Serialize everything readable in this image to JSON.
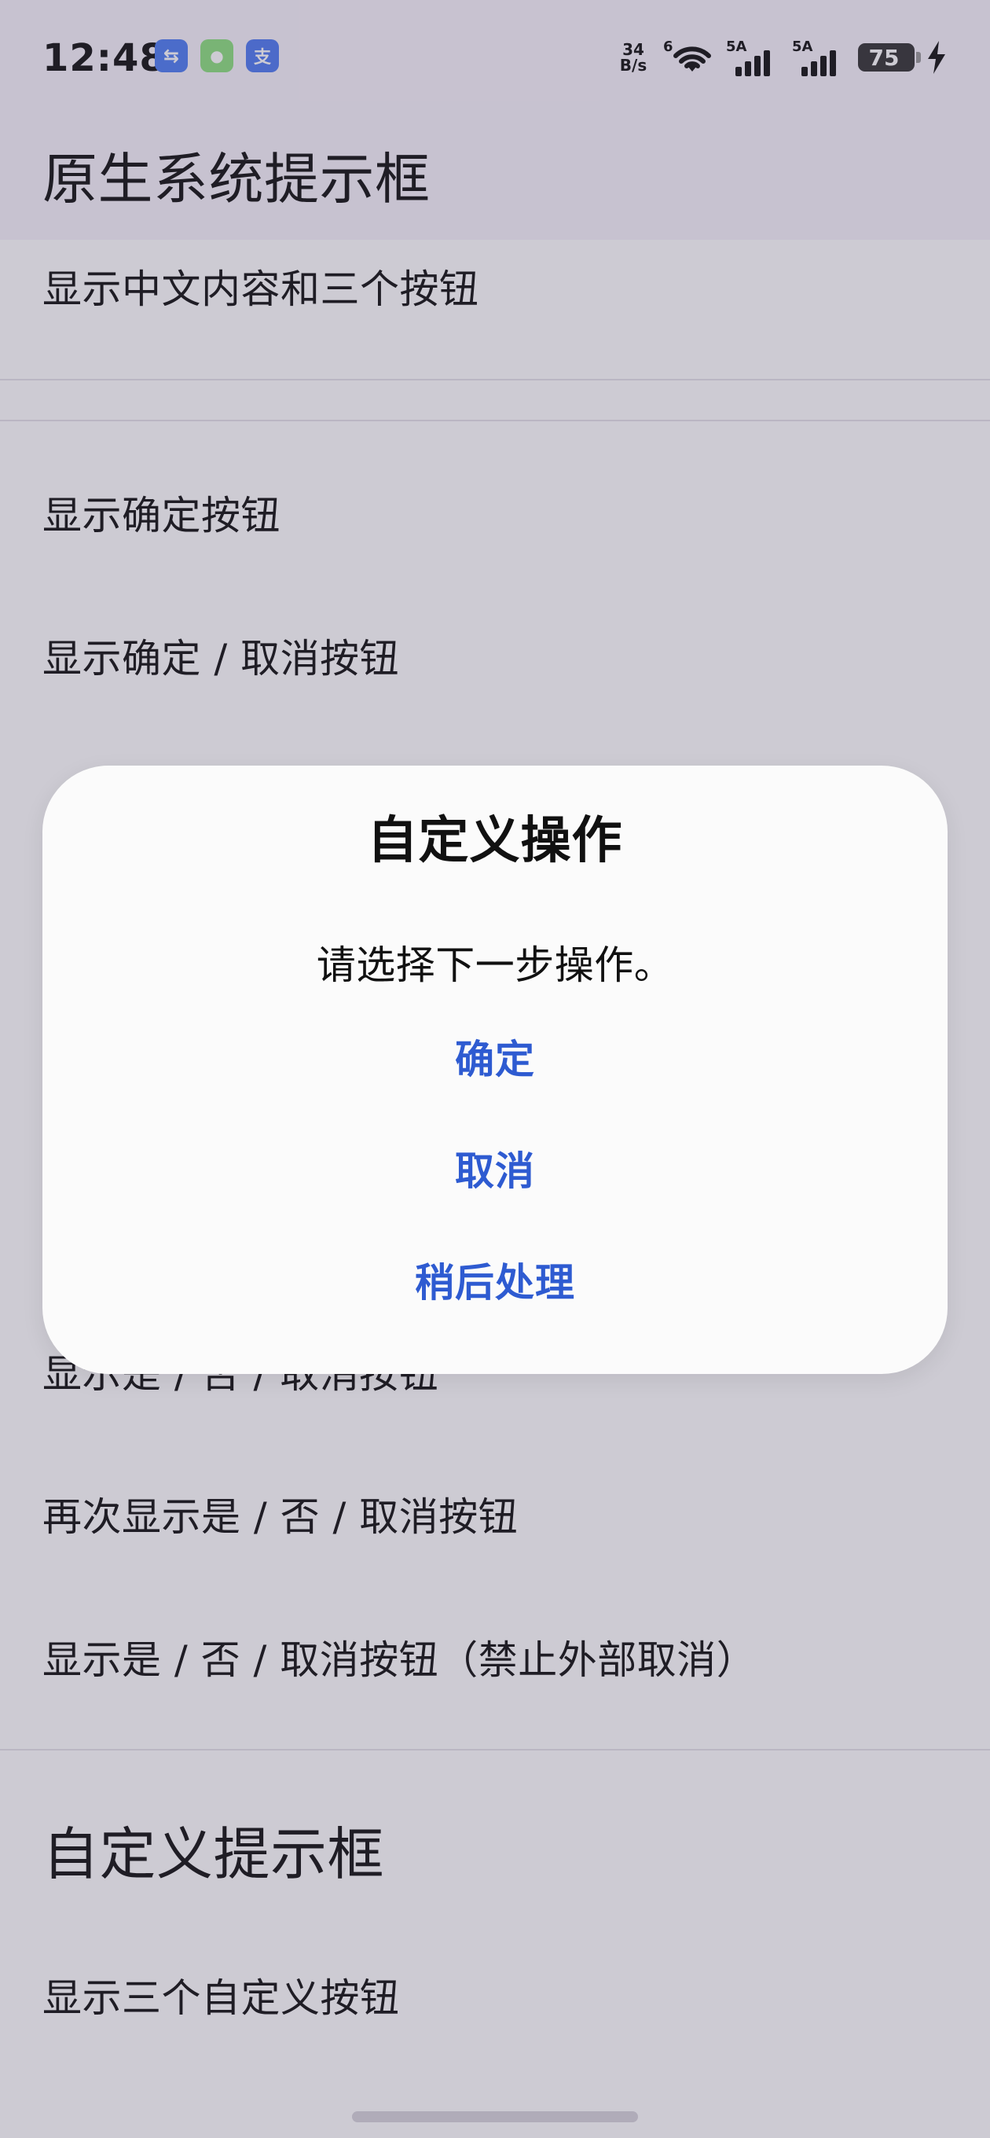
{
  "status_bar": {
    "time": "12:48",
    "net_speed_value": "34",
    "net_speed_unit": "B/s",
    "wifi_label": "6",
    "signal_1_label": "5A",
    "signal_2_label": "5A",
    "battery_level": "75",
    "app_icons": [
      {
        "name": "usb-debug-icon",
        "glyph": "⇆",
        "color": "#4d7df3"
      },
      {
        "name": "message-app-icon",
        "glyph": "●",
        "color": "#8ce07f"
      },
      {
        "name": "alipay-icon",
        "glyph": "支",
        "color": "#4f7bf1"
      }
    ]
  },
  "header": {
    "title": "原生系统提示框"
  },
  "content": {
    "items": [
      "显示中文内容和三个按钮",
      "显示确定按钮",
      "显示确定 / 取消按钮",
      "显示是 / 否 / 取消按钮",
      "再次显示是 / 否 / 取消按钮",
      "显示是 / 否 / 取消按钮（禁止外部取消）"
    ],
    "section_title": "自定义提示框",
    "custom_item": "显示三个自定义按钮"
  },
  "dialog": {
    "title": "自定义操作",
    "message": "请选择下一步操作。",
    "buttons": [
      "确定",
      "取消",
      "稍后处理"
    ],
    "accent_color": "#2e5bd1"
  }
}
